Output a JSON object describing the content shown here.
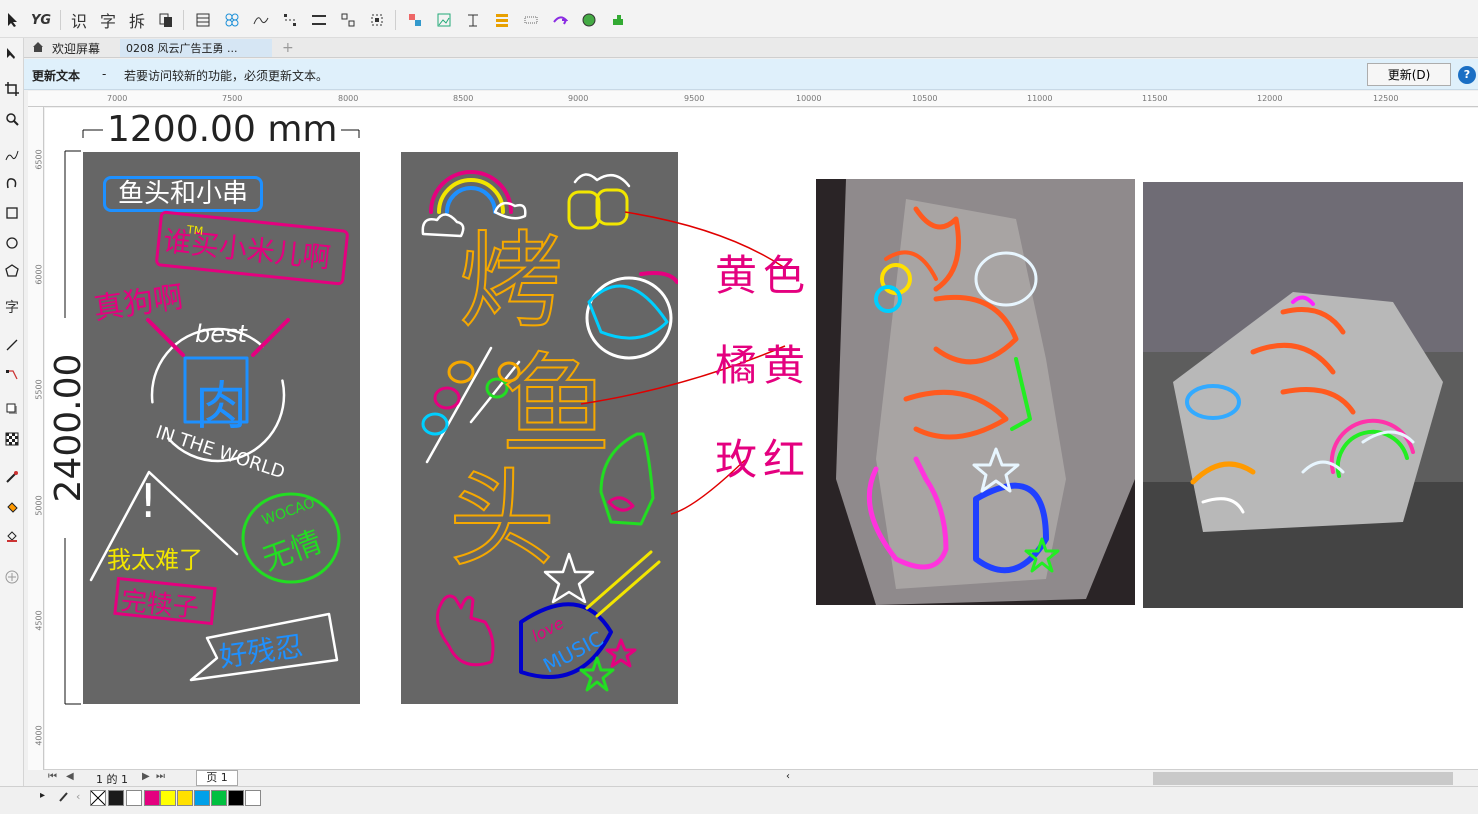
{
  "tabs": {
    "welcome": "欢迎屏幕",
    "document": "0208 风云广告王勇 ..."
  },
  "notice": {
    "title": "更新文本",
    "dash": "-",
    "message": "若要访问较新的功能，必须更新文本。",
    "button": "更新(D)"
  },
  "ruler": {
    "h": [
      "7000",
      "7500",
      "8000",
      "8500",
      "9000",
      "9500",
      "10000",
      "10500",
      "11000",
      "11500",
      "12000",
      "12500"
    ],
    "v": [
      "6500",
      "6000",
      "5500",
      "5000",
      "4500",
      "4000"
    ]
  },
  "dimensions": {
    "width": "1200.00 mm",
    "height": "2400.00 mm"
  },
  "design1": {
    "box_text": "鱼头和小串",
    "bubble_text": "谁买小米儿啊",
    "bubble_small": "TM",
    "real_dog": "真狗啊",
    "best": "best",
    "meat": "肉",
    "in_the_world": "IN THE WORLD",
    "exclaim": "!",
    "too_hard": "我太难了",
    "finish": "完犊子",
    "cruel": "好残忍",
    "heartless": "无情",
    "wocao": "WOCAO"
  },
  "design2": {
    "kao": "烤",
    "yu": "鱼",
    "tou": "头",
    "love": "love",
    "music": "MUSIC"
  },
  "labels": {
    "yellow": "黄色",
    "orange": "橘黄",
    "rose": "玫红"
  },
  "pagenav": {
    "page_of": "1 的 1",
    "page_tab": "页 1"
  },
  "palette": [
    "#ffffff",
    "#1a1a1a",
    "#ffffff",
    "#e4007f",
    "#ffff00",
    "#ffe000",
    "#00a0e9",
    "#00c040",
    "#000000",
    "#ffffff"
  ],
  "colors": {
    "panel_gray": "#666666",
    "neon_yellow": "#f2e600",
    "neon_orange": "#f5a800",
    "neon_pink": "#e4007f",
    "neon_blue": "#1e90ff",
    "neon_green": "#22dd22",
    "label_red": "#e4007f"
  }
}
